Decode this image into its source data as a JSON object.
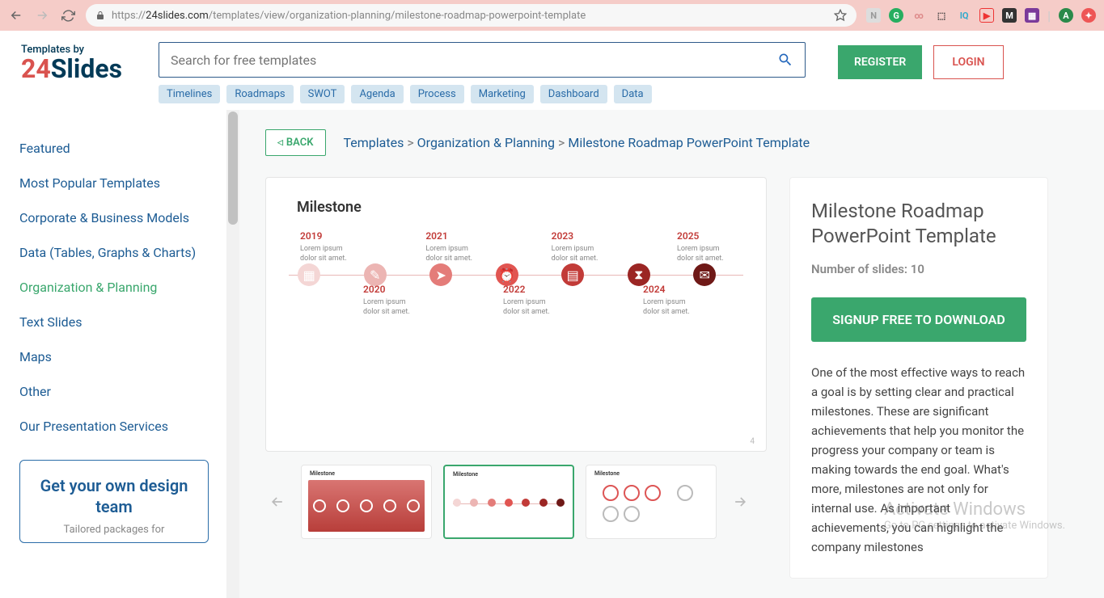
{
  "browser": {
    "url_host": "24slides.com",
    "url_path": "/templates/view/organization-planning/milestone-roadmap-powerpoint-template"
  },
  "header": {
    "logo_line1": "Templates by",
    "logo_line2a": "24",
    "logo_line2b": "Slides",
    "search_placeholder": "Search for free templates",
    "tags": [
      "Timelines",
      "Roadmaps",
      "SWOT",
      "Agenda",
      "Process",
      "Marketing",
      "Dashboard",
      "Data"
    ],
    "register": "REGISTER",
    "login": "LOGIN"
  },
  "sidebar": {
    "items": [
      {
        "label": "Featured"
      },
      {
        "label": "Most Popular Templates"
      },
      {
        "label": "Corporate & Business Models"
      },
      {
        "label": "Data (Tables, Graphs & Charts)"
      },
      {
        "label": "Organization & Planning",
        "active": true
      },
      {
        "label": "Text Slides"
      },
      {
        "label": "Maps"
      },
      {
        "label": "Other"
      },
      {
        "label": "Our Presentation Services"
      }
    ],
    "cta_title": "Get your own design team",
    "cta_sub": "Tailored packages for"
  },
  "crumbs": {
    "back": "BACK",
    "part1": "Templates",
    "part2": "Organization & Planning",
    "part3": "Milestone Roadmap PowerPoint Template"
  },
  "preview": {
    "title": "Milestone",
    "years_top": [
      "2019",
      "2021",
      "2023",
      "2025"
    ],
    "years_bot": [
      "2020",
      "2022",
      "2024"
    ],
    "lorem": "Lorem ipsum dolor sit amet.",
    "page_num": "4",
    "thumbs": [
      "Milestone",
      "Milestone",
      "Milestone"
    ]
  },
  "info": {
    "title": "Milestone Roadmap PowerPoint Template",
    "slides_label": "Number of slides: 10",
    "download": "SIGNUP FREE TO DOWNLOAD",
    "desc": "One of the most effective ways to reach a goal is by setting clear and practical milestones. These are significant achievements that help you monitor the progress your company or team is making towards the end goal. What's more, milestones are not only for internal use. As important achievements, you can highlight the company milestones"
  },
  "watermark": {
    "l1": "Activate Windows",
    "l2": "Go to PC settings to activate Windows."
  }
}
